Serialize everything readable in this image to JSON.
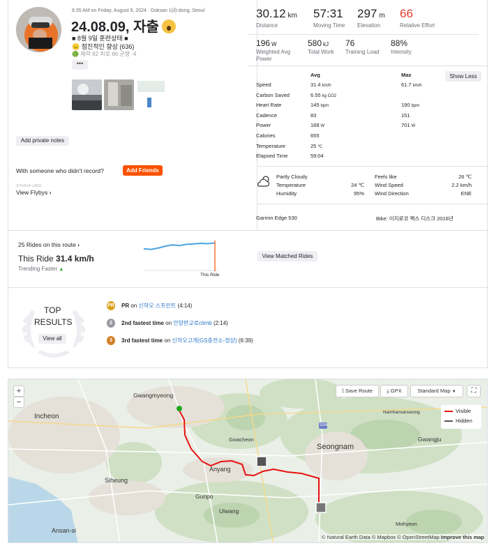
{
  "activity": {
    "date_location": "6:35 AM on Friday, August 9, 2024 · Doksan 1(il)-dong, Seoul",
    "title": "24.08.09, 자출",
    "desc_line1": "■ 8월 9일 훈련상태 ■",
    "desc_line2": "😑 점진적인 향상 (636)",
    "desc_line3": "🟢 체력 82 피로 66 균형 -4",
    "more_label": "•••"
  },
  "actions": {
    "private_notes": "Add private notes",
    "someone_prompt": "With someone who didn't record?",
    "add_friends": "Add Friends",
    "flybys_caption": "STRAVA LABS",
    "view_flybys": "View Flybys"
  },
  "stats_main": [
    {
      "value": "30.12",
      "unit": "km",
      "label": "Distance"
    },
    {
      "value": "57:31",
      "unit": "",
      "label": "Moving Time"
    },
    {
      "value": "297",
      "unit": "m",
      "label": "Elevation"
    },
    {
      "value": "66",
      "unit": "",
      "label": "Relative Effort"
    }
  ],
  "stats_secondary": [
    {
      "value": "196",
      "unit": "W",
      "label": "Weighted Avg Power"
    },
    {
      "value": "580",
      "unit": "kJ",
      "label": "Total Work"
    },
    {
      "value": "76",
      "unit": "",
      "label": "Training Load"
    },
    {
      "value": "88%",
      "unit": "",
      "label": "Intensity"
    }
  ],
  "details": {
    "col_avg": "Avg",
    "col_max": "Max",
    "show_less": "Show Less",
    "rows": [
      {
        "label": "Speed",
        "avg": "31.4",
        "avg_unit": "km/h",
        "max": "61.7",
        "max_unit": "km/h"
      },
      {
        "label": "Carbon Saved",
        "avg": "6.55",
        "avg_unit": "kg CO2",
        "max": "",
        "max_unit": ""
      },
      {
        "label": "Heart Rate",
        "avg": "145",
        "avg_unit": "bpm",
        "max": "190",
        "max_unit": "bpm"
      },
      {
        "label": "Cadence",
        "avg": "83",
        "avg_unit": "",
        "max": "151",
        "max_unit": ""
      },
      {
        "label": "Power",
        "avg": "168",
        "avg_unit": "W",
        "max": "701",
        "max_unit": "W"
      },
      {
        "label": "Calories",
        "avg": "655",
        "avg_unit": "",
        "max": "",
        "max_unit": ""
      },
      {
        "label": "Temperature",
        "avg": "25",
        "avg_unit": "℃",
        "max": "",
        "max_unit": ""
      },
      {
        "label": "Elapsed Time",
        "avg": "59:04",
        "avg_unit": "",
        "max": "",
        "max_unit": ""
      }
    ]
  },
  "weather": {
    "condition": "Partly Cloudy",
    "temp_label": "Temperature",
    "temp_value": "24 ℃",
    "humidity_label": "Humidity",
    "humidity_value": "95%",
    "feels_label": "Feels like",
    "feels_value": "26 ℃",
    "wind_label": "Wind Speed",
    "wind_value": "2.2 km/h",
    "dir_label": "Wind Direction",
    "dir_value": "ENE"
  },
  "device": "Garmin Edge 530",
  "bike": "Bike: 이지로코 팩스 디스크 2016년",
  "trend": {
    "rides_link": "25 Rides on this route",
    "this_ride_label": "This Ride",
    "this_ride_value": "31.4 km/h",
    "trending": "Trending Faster",
    "marker_label": "This Ride",
    "view_matched": "View Matched Rides",
    "series": [
      0.3,
      0.32,
      0.28,
      0.22,
      0.18,
      0.2,
      0.16,
      0.15,
      0.13,
      0.14,
      0.12
    ]
  },
  "results": {
    "header_line1": "TOP",
    "header_line2": "RESULTS",
    "view_all": "View all",
    "items": [
      {
        "badge": "PR",
        "prefix": "PR",
        "on": " on ",
        "segment": "신하오 스프린트",
        "time": " (4:14)"
      },
      {
        "badge": "2",
        "prefix": "2nd fastest time",
        "on": " on ",
        "segment": "안양판교로climb",
        "time": " (2:14)"
      },
      {
        "badge": "3",
        "prefix": "3rd fastest time",
        "on": " on ",
        "segment": "신하오고개(GS충전소-정상)",
        "time": " (6:39)"
      }
    ]
  },
  "map": {
    "zoom_in": "+",
    "zoom_out": "−",
    "save_route": "Save Route",
    "gpx": "GPX",
    "map_type": "Standard Map",
    "legend_visible": "Visible",
    "legend_hidden": "Hidden",
    "attribution": "© Natural Earth Data © Mapbox © OpenStreetMap",
    "improve": "Improve this map",
    "places": [
      {
        "name": "Gwangmyeong"
      },
      {
        "name": "Incheon"
      },
      {
        "name": "Gwacheon"
      },
      {
        "name": "Seongnam"
      },
      {
        "name": "Gwangju"
      },
      {
        "name": "Anyang"
      },
      {
        "name": "Siheung"
      },
      {
        "name": "Gunpo"
      },
      {
        "name": "Uiwang"
      },
      {
        "name": "Ansan-si"
      },
      {
        "name": "Mohyeon"
      },
      {
        "name": "Namhansanseong"
      },
      {
        "name": "SSN"
      }
    ]
  },
  "colors": {
    "accent": "#fc5200",
    "relative_effort": "#e03b2a",
    "link": "#2c7ac9",
    "route": "#e8100f",
    "start": "#1fa81f",
    "trend_line": "#4ba3e3"
  }
}
